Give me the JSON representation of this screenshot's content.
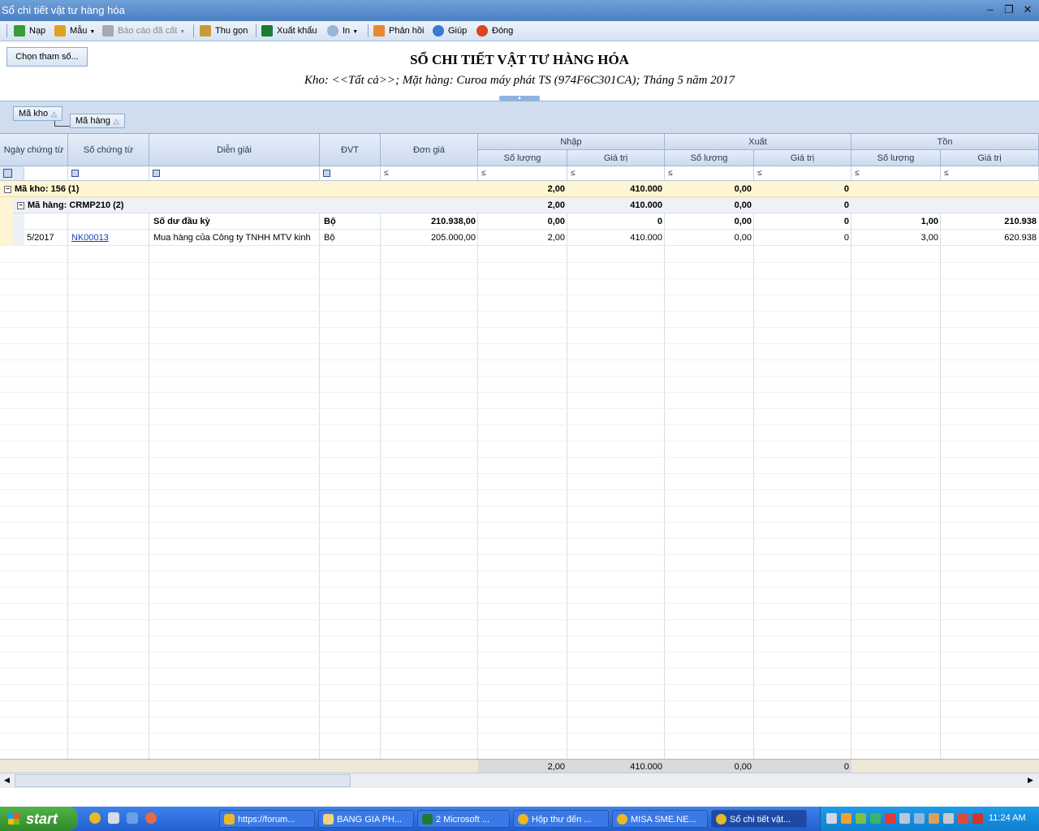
{
  "window": {
    "title": "Sổ chi tiết vật tư hàng hóa",
    "min": "–",
    "restore": "❐",
    "close": "✕"
  },
  "toolbar": {
    "nap": "Nạp",
    "mau": "Mẫu",
    "bao_cao_da_cat": "Báo cáo đã cất",
    "thu_gon": "Thu gọn",
    "xuat_khau": "Xuất khẩu",
    "in": "In",
    "phan_hoi": "Phản hồi",
    "giup": "Giúp",
    "dong": "Đóng"
  },
  "report": {
    "choose_params": "Chọn tham số...",
    "title": "SỔ CHI TIẾT VẬT TƯ HÀNG HÓA",
    "subtitle": "Kho: <<Tất cả>>; Mặt hàng: Curoa máy phát TS (974F6C301CA); Tháng 5 năm 2017"
  },
  "group_panel": {
    "level1": "Mã kho",
    "level2": "Mã hàng"
  },
  "columns": {
    "ngay": "Ngày chứng từ",
    "so": "Số chứng từ",
    "dien_giai": "Diễn giải",
    "dvt": "ĐVT",
    "don_gia": "Đơn giá",
    "nhap": "Nhập",
    "xuat": "Xuất",
    "ton": "Tồn",
    "so_luong": "Số lượng",
    "gia_tri": "Giá trị"
  },
  "filter_ops": {
    "le": "≤"
  },
  "groups": {
    "kho": {
      "label": "Mã kho: 156 (1)",
      "nhap_sl": "2,00",
      "nhap_gt": "410.000",
      "xuat_sl": "0,00",
      "xuat_gt": "0"
    },
    "hang": {
      "label": "Mã hàng: CRMP210 (2)",
      "nhap_sl": "2,00",
      "nhap_gt": "410.000",
      "xuat_sl": "0,00",
      "xuat_gt": "0"
    }
  },
  "rows": [
    {
      "ngay": "",
      "so": "",
      "dien_giai": "Số dư đầu kỳ",
      "dvt": "Bộ",
      "don_gia": "210.938,00",
      "nhap_sl": "0,00",
      "nhap_gt": "0",
      "xuat_sl": "0,00",
      "xuat_gt": "0",
      "ton_sl": "1,00",
      "ton_gt": "210.938"
    },
    {
      "ngay": "5/2017",
      "so": "NK00013",
      "dien_giai": "Mua hàng của Công ty TNHH MTV kinh",
      "dvt": "Bộ",
      "don_gia": "205.000,00",
      "nhap_sl": "2,00",
      "nhap_gt": "410.000",
      "xuat_sl": "0,00",
      "xuat_gt": "0",
      "ton_sl": "3,00",
      "ton_gt": "620.938"
    }
  ],
  "footer": {
    "nhap_sl": "2,00",
    "nhap_gt": "410.000",
    "xuat_sl": "0,00",
    "xuat_gt": "0"
  },
  "taskbar": {
    "start": "start",
    "tasks": [
      "https://forum...",
      "BANG GIA PH...",
      "2 Microsoft ...",
      "Hộp thư đến ...",
      "MISA SME.NE...",
      "Sổ chi tiết vật..."
    ],
    "clock": "11:24 AM"
  }
}
